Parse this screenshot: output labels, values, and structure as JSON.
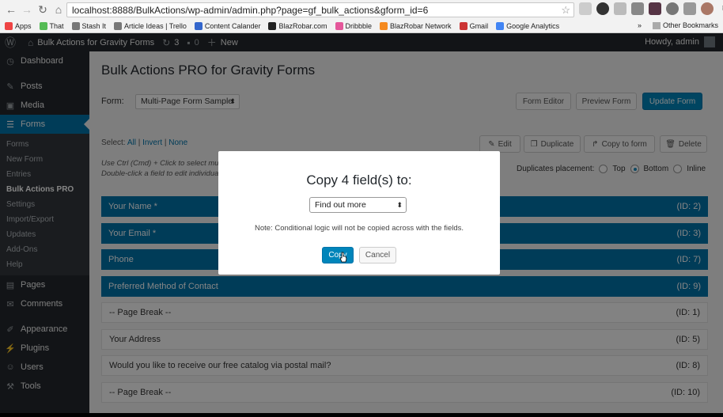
{
  "browser": {
    "url": "localhost:8888/BulkActions/wp-admin/admin.php?page=gf_bulk_actions&gform_id=6",
    "bookmarks": [
      "Apps",
      "That",
      "Stash It",
      "Article Ideas | Trello",
      "Content Calander",
      "BlazRobar.com",
      "Dribbble",
      "BlazRobar Network",
      "Gmail",
      "Google Analytics"
    ],
    "bookmark_colors": [
      "#e44",
      "#5b5",
      "#777",
      "#777",
      "#36c",
      "#222",
      "#e4579a",
      "#f58a1f",
      "#c33",
      "#4285f4"
    ],
    "other_bookmarks": "Other Bookmarks",
    "overflow": "»"
  },
  "adminbar": {
    "site_name": "Bulk Actions for Gravity Forms",
    "updates_count": "3",
    "comments_count": "0",
    "new_label": "New",
    "howdy": "Howdy, admin"
  },
  "sidebar": {
    "items_top": [
      {
        "label": "Dashboard",
        "icon": "dashboard-icon",
        "glyph": "◷"
      },
      {
        "label": "Posts",
        "icon": "pin-icon",
        "glyph": "✎"
      },
      {
        "label": "Media",
        "icon": "media-icon",
        "glyph": "▣"
      },
      {
        "label": "Forms",
        "icon": "forms-icon",
        "glyph": "☰"
      }
    ],
    "forms_sub": [
      "Forms",
      "New Form",
      "Entries",
      "Bulk Actions PRO",
      "Settings",
      "Import/Export",
      "Updates",
      "Add-Ons",
      "Help"
    ],
    "items_bottom": [
      {
        "label": "Pages",
        "icon": "pages-icon",
        "glyph": "▤"
      },
      {
        "label": "Comments",
        "icon": "comments-icon",
        "glyph": "✉"
      },
      {
        "label": "Appearance",
        "icon": "appearance-icon",
        "glyph": "✐"
      },
      {
        "label": "Plugins",
        "icon": "plugins-icon",
        "glyph": "⚡"
      },
      {
        "label": "Users",
        "icon": "users-icon",
        "glyph": "☺"
      },
      {
        "label": "Tools",
        "icon": "tools-icon",
        "glyph": "⚒"
      }
    ]
  },
  "main": {
    "title": "Bulk Actions PRO for Gravity Forms",
    "form_label": "Form:",
    "form_selected": "Multi-Page Form Sample",
    "form_editor": "Form Editor",
    "preview_form": "Preview Form",
    "update_form": "Update Form",
    "select_label": "Select:",
    "select_all": "All",
    "select_invert": "Invert",
    "select_none": "None",
    "hint_line1": "Use Ctrl (Cmd) + Click to select multipl",
    "hint_line2": "Double-click a field to edit individual",
    "actions": {
      "edit": "Edit",
      "duplicate": "Duplicate",
      "copy": "Copy to form",
      "delete": "Delete"
    },
    "dup_label": "Duplicates placement:",
    "dup_options": [
      "Top",
      "Bottom",
      "Inline"
    ],
    "dup_selected": "Bottom",
    "fields": [
      {
        "label": "Your Name *",
        "id": "(ID: 2)",
        "selected": true
      },
      {
        "label": "Your Email *",
        "id": "(ID: 3)",
        "selected": true
      },
      {
        "label": "Phone",
        "id": "(ID: 7)",
        "selected": true
      },
      {
        "label": "Preferred Method of Contact",
        "id": "(ID: 9)",
        "selected": true
      },
      {
        "label": "-- Page Break --",
        "id": "(ID: 1)",
        "selected": false
      },
      {
        "label": "Your Address",
        "id": "(ID: 5)",
        "selected": false
      },
      {
        "label": "Would you like to receive our free catalog via postal mail?",
        "id": "(ID: 8)",
        "selected": false
      },
      {
        "label": "-- Page Break --",
        "id": "(ID: 10)",
        "selected": false
      }
    ]
  },
  "modal": {
    "title": "Copy 4 field(s) to:",
    "selected_form": "Find out more",
    "note": "Note: Conditional logic will not be copied across with the fields.",
    "copy_label": "Copy",
    "cancel_label": "Cancel"
  },
  "colors": {
    "accent": "#0073aa",
    "adminbar": "#23282d",
    "sidebar": "#23282d"
  }
}
